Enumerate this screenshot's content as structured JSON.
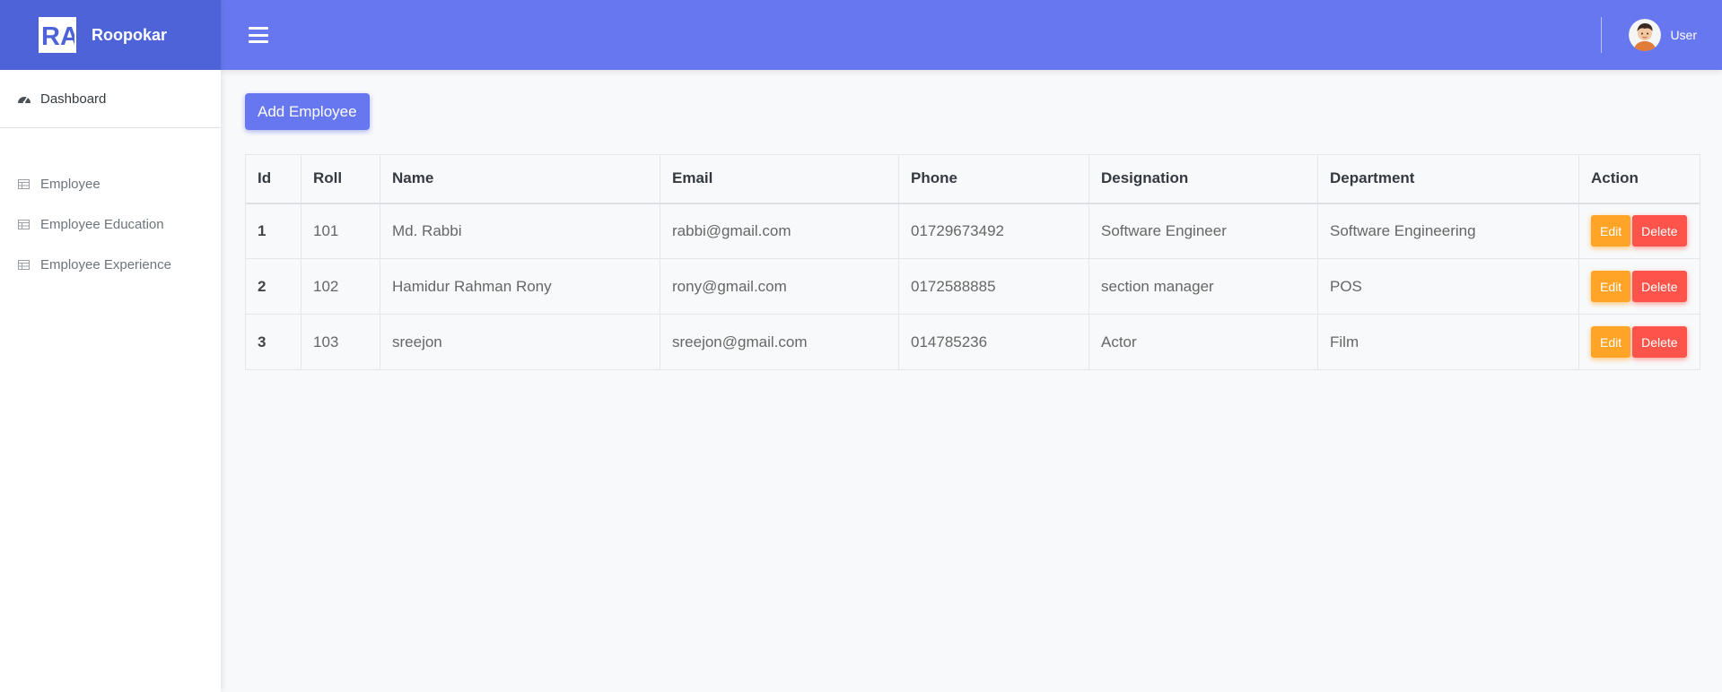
{
  "brand": {
    "logo_text": "RA",
    "name": "Roopokar"
  },
  "sidebar": {
    "dashboard_label": "Dashboard",
    "items": [
      {
        "label": "Employee",
        "icon": "table-icon"
      },
      {
        "label": "Employee Education",
        "icon": "table-icon"
      },
      {
        "label": "Employee Experience",
        "icon": "table-icon"
      }
    ]
  },
  "topbar": {
    "user_name": "User"
  },
  "main": {
    "add_button_label": "Add Employee"
  },
  "table": {
    "headers": [
      "Id",
      "Roll",
      "Name",
      "Email",
      "Phone",
      "Designation",
      "Department",
      "Action"
    ],
    "rows": [
      {
        "id": "1",
        "roll": "101",
        "name": "Md. Rabbi",
        "email": "rabbi@gmail.com",
        "phone": "01729673492",
        "designation": "Software Engineer",
        "department": "Software Engineering",
        "edit_label": "Edit",
        "delete_label": "Delete"
      },
      {
        "id": "2",
        "roll": "102",
        "name": "Hamidur Rahman Rony",
        "email": "rony@gmail.com",
        "phone": "0172588885",
        "designation": "section manager",
        "department": "POS",
        "edit_label": "Edit",
        "delete_label": "Delete"
      },
      {
        "id": "3",
        "roll": "103",
        "name": "sreejon",
        "email": "sreejon@gmail.com",
        "phone": "014785236",
        "designation": "Actor",
        "department": "Film",
        "edit_label": "Edit",
        "delete_label": "Delete"
      }
    ]
  },
  "colors": {
    "brand_dark": "#4e63d7",
    "primary": "#6777ef",
    "warning": "#ffa426",
    "danger": "#fc544b"
  }
}
